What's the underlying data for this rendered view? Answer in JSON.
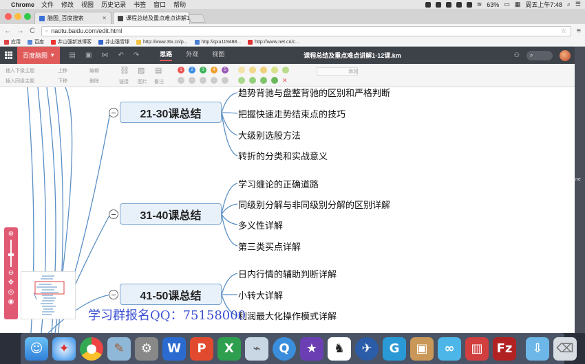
{
  "menubar": {
    "app_name": "Chrome",
    "menus": [
      "文件",
      "修改",
      "视图",
      "历史记录",
      "书签",
      "窗口",
      "帮助"
    ],
    "battery": "63%",
    "clock": "周五上午7:48"
  },
  "tabs": [
    {
      "title": "脑图_百度搜索"
    },
    {
      "title": "课程总结及重点难点讲解1-12..."
    }
  ],
  "toolbar": {
    "url": "naotu.baidu.com/edit.html"
  },
  "bookmarks": [
    {
      "label": "应用"
    },
    {
      "label": "百度"
    },
    {
      "label": "井山强新浪博客"
    },
    {
      "label": "井山强雪球"
    },
    {
      "label": "http://www.3tx.cn/p..."
    },
    {
      "label": "http://qxu119488..."
    },
    {
      "label": "http://www.net.cn/c..."
    }
  ],
  "naotu": {
    "brand": "百度脑图",
    "tabs": [
      "思路",
      "外观",
      "视图"
    ],
    "doc_title": "课程总结及重点难点讲解1-12课.km"
  },
  "edit_tools": {
    "insert_child": "插入下级主题",
    "insert_sibling": "插入同级主题",
    "move_up": "上移",
    "move_down": "下移",
    "edit": "编辑",
    "delete": "删除",
    "link": "链接",
    "image": "图片",
    "note": "备注",
    "priority_labels": [
      "1",
      "2",
      "3",
      "4",
      "5"
    ],
    "add_label": "添加"
  },
  "mindmap": {
    "top_partial": "趋势背驰与盘整背驰的区别和严格判断",
    "groups": [
      {
        "title": "21-30课总结",
        "items": [
          "把握快速走势结束点的技巧",
          "大级别选股方法",
          "转折的分类和实战意义"
        ]
      },
      {
        "title": "31-40课总结",
        "items": [
          "学习缠论的正确道路",
          "同级别分解与非同级别分解的区别详解",
          "多义性详解",
          "第三类买点详解"
        ]
      },
      {
        "title": "41-50课总结",
        "items": [
          "日内行情的辅助判断详解",
          "小转大详解",
          "利润最大化操作模式详解"
        ]
      }
    ],
    "watermark": "学习群报名QQ：75158000"
  },
  "right_strip": {
    "label": "ne"
  },
  "colors": {
    "accent": "#e05a5a",
    "node_fill": "#e8f1fa",
    "node_border": "#7aa5cf",
    "watermark": "#3a4fd2"
  }
}
